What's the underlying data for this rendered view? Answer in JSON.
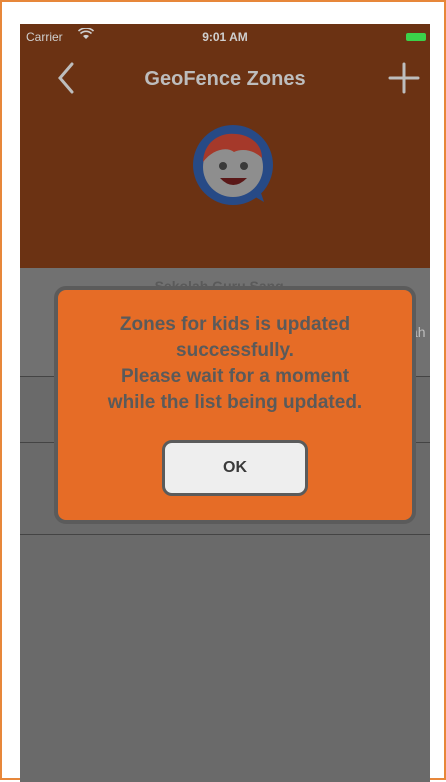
{
  "status_bar": {
    "carrier": "Carrier",
    "time": "9:01 AM"
  },
  "navbar": {
    "title": "GeoFence Zones"
  },
  "list": {
    "rows": [
      {
        "title": "Sekolah Guru Sang...",
        "trailing": "ah"
      }
    ]
  },
  "alert": {
    "message_lines": [
      "Zones for kids is updated",
      "successfully.",
      "Please wait for a moment",
      "while the list being updated."
    ],
    "ok_label": "OK"
  },
  "colors": {
    "header_bg": "#6b3213",
    "alert_bg": "#e66c26",
    "overlay": "#6a6a6a",
    "frame_border": "#e7873a"
  }
}
